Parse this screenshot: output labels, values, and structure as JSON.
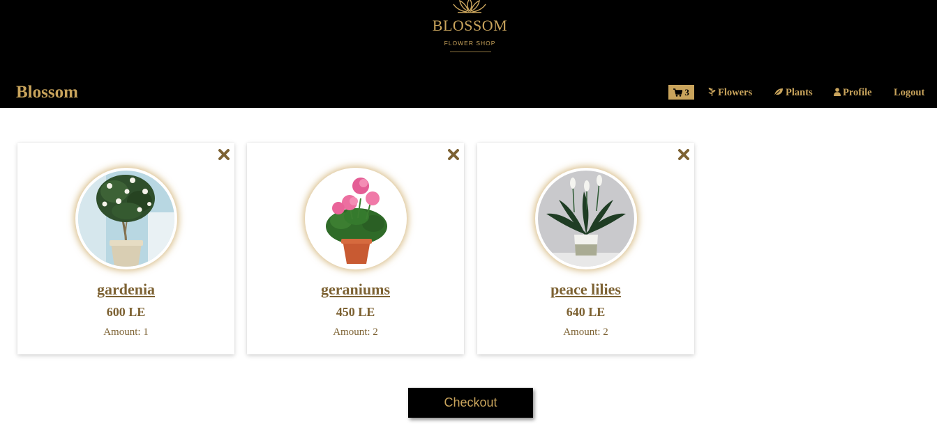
{
  "header": {
    "logo_name": "BLOSSOM",
    "logo_subtitle": "FLOWER SHOP",
    "brand": "Blossom"
  },
  "nav": {
    "cart_count": "3",
    "items": [
      {
        "label": "Flowers",
        "icon": "pagelines-icon"
      },
      {
        "label": "Plants",
        "icon": "leaf-icon"
      },
      {
        "label": "Profile",
        "icon": "user-icon"
      },
      {
        "label": "Logout",
        "icon": ""
      }
    ]
  },
  "cart": {
    "items": [
      {
        "name": "gardenia",
        "price": "600 LE",
        "amount": "Amount: 1",
        "image": "gardenia-plant-image"
      },
      {
        "name": "geraniums",
        "price": "450 LE",
        "amount": "Amount: 2",
        "image": "geraniums-plant-image"
      },
      {
        "name": "peace lilies",
        "price": "640 LE",
        "amount": "Amount: 2",
        "image": "peace-lilies-plant-image"
      }
    ],
    "checkout_label": "Checkout"
  },
  "colors": {
    "gold": "#c9a45c",
    "brown_text": "#7d6233",
    "header_bg": "#000000"
  }
}
